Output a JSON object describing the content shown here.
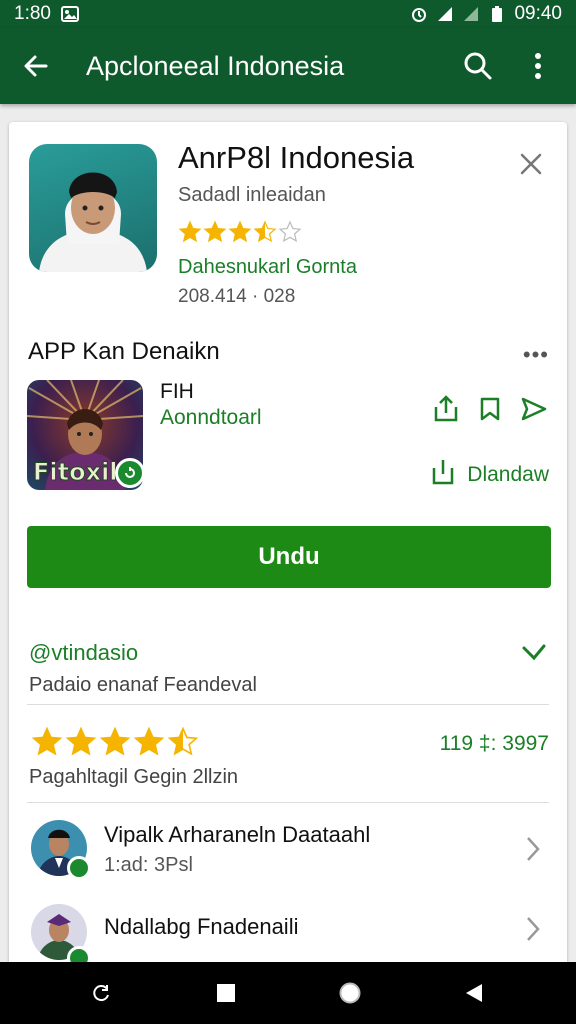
{
  "status_bar": {
    "time": "1:80",
    "battery_time": "09:40"
  },
  "app_bar": {
    "title": "Apcloneeal Indonesia"
  },
  "app": {
    "title": "AnrP8l Indonesia",
    "subtitle": "Sadadl inleaidan",
    "rating_stars": 3.5,
    "developer": "Dahesnukarl Gornta",
    "dates": "208.414 · 028"
  },
  "recommended": {
    "section_title": "APP Kan Denaikn",
    "more": "•••",
    "name": "FIH",
    "subtitle": "Aonndtoarl",
    "icon_text": "Fitoxil",
    "download_label": "Dlandaw"
  },
  "primary_button": {
    "label": "Undu"
  },
  "section_link": {
    "label": "@vtindasio",
    "description": "Padaio enanaf Feandeval"
  },
  "rating": {
    "stars": 4.5,
    "count": "119 ‡: 3997",
    "description": "Pagahltagil Gegin 2llzin"
  },
  "list": [
    {
      "title": "Vipalk Arharaneln Daataahl",
      "subtitle": "1:ad: 3Psl"
    },
    {
      "title": "Ndallabg Fnadenaili",
      "subtitle": ""
    }
  ],
  "colors": {
    "primary_dark": "#0f5a2d",
    "accent_green": "#1e8a16",
    "link_green": "#1b7f27",
    "star": "#f4b400"
  }
}
